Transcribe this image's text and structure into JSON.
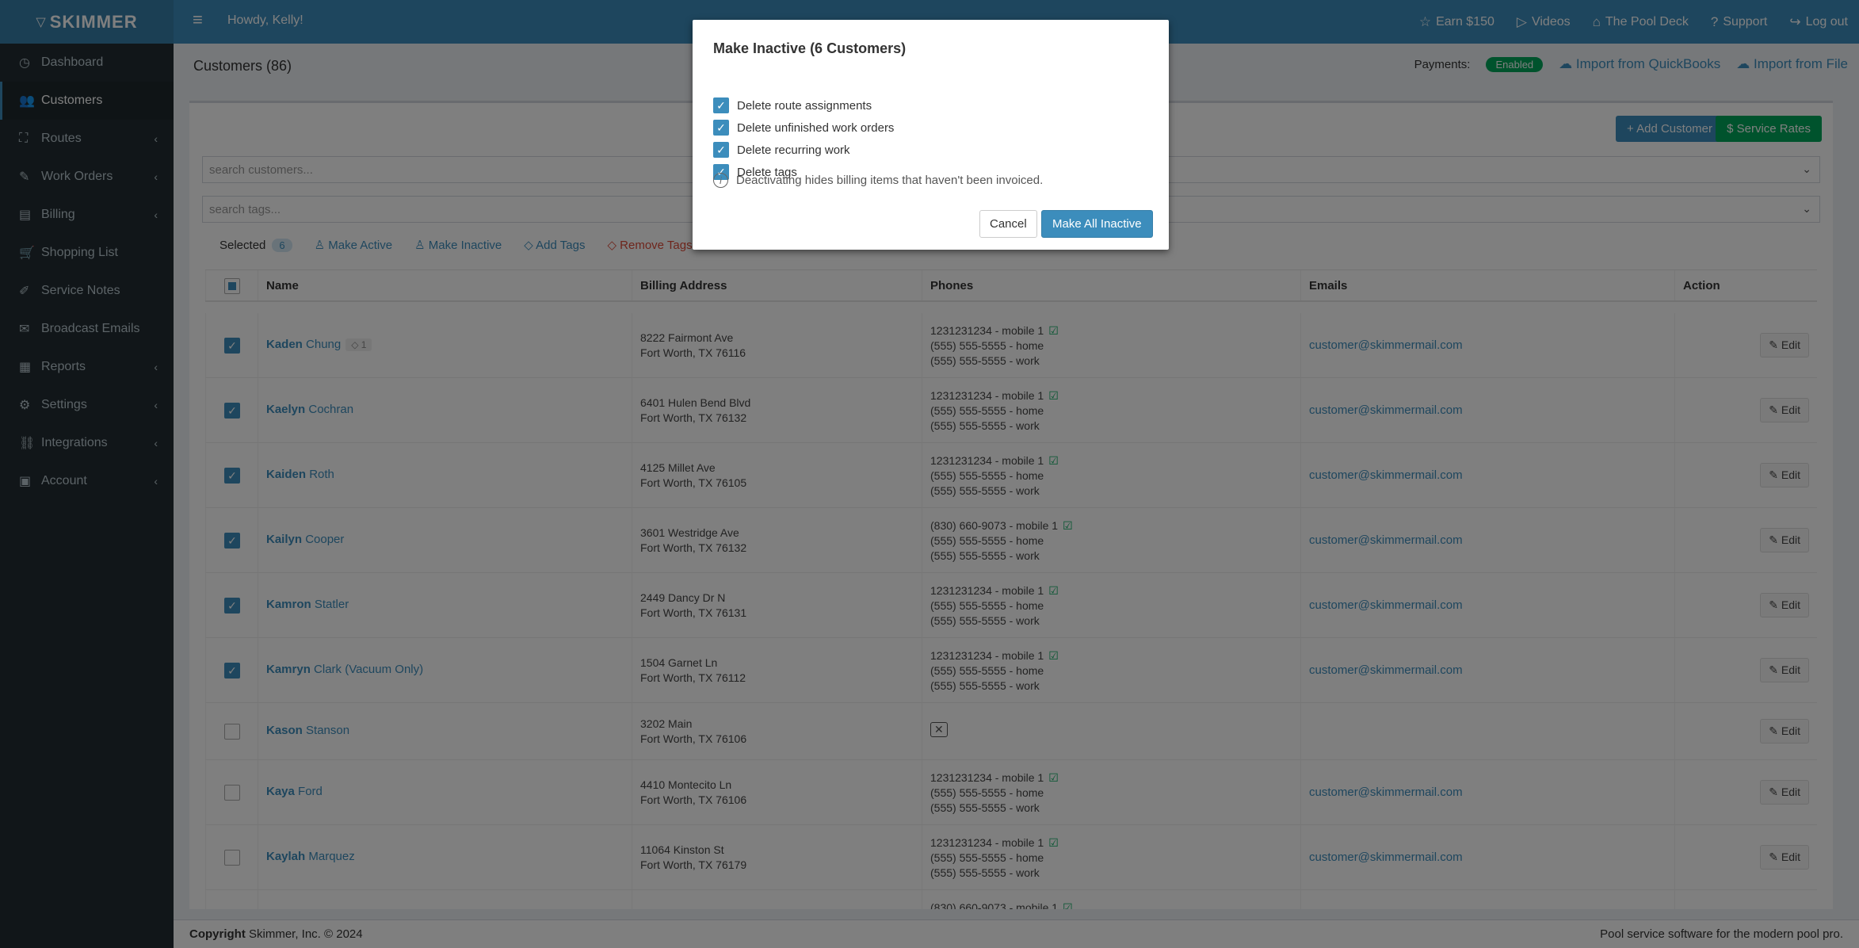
{
  "app": {
    "logo": "SKIMMER",
    "greeting": "Howdy, Kelly!"
  },
  "topnav": [
    {
      "icon": "star-icon",
      "glyph": "☆",
      "label": "Earn $150"
    },
    {
      "icon": "play-icon",
      "glyph": "▷",
      "label": "Videos"
    },
    {
      "icon": "pool-icon",
      "glyph": "⌂",
      "label": "The Pool Deck"
    },
    {
      "icon": "question-icon",
      "glyph": "?",
      "label": "Support"
    },
    {
      "icon": "logout-icon",
      "glyph": "↪",
      "label": "Log out"
    }
  ],
  "sidebar": {
    "items": [
      {
        "label": "Dashboard",
        "glyph": "◷",
        "chevron": false,
        "active": false
      },
      {
        "label": "Customers",
        "glyph": "👥",
        "chevron": false,
        "active": true
      },
      {
        "label": "Routes",
        "glyph": "⛶",
        "chevron": true,
        "active": false
      },
      {
        "label": "Work Orders",
        "glyph": "✎",
        "chevron": true,
        "active": false
      },
      {
        "label": "Billing",
        "glyph": "▤",
        "chevron": true,
        "active": false
      },
      {
        "label": "Shopping List",
        "glyph": "🛒",
        "chevron": false,
        "active": false
      },
      {
        "label": "Service Notes",
        "glyph": "✐",
        "chevron": false,
        "active": false
      },
      {
        "label": "Broadcast Emails",
        "glyph": "✉",
        "chevron": false,
        "active": false
      },
      {
        "label": "Reports",
        "glyph": "▦",
        "chevron": true,
        "active": false
      },
      {
        "label": "Settings",
        "glyph": "⚙",
        "chevron": true,
        "active": false
      },
      {
        "label": "Integrations",
        "glyph": "⛓",
        "chevron": true,
        "active": false
      },
      {
        "label": "Account",
        "glyph": "▣",
        "chevron": true,
        "active": false
      }
    ]
  },
  "header": {
    "title": "Customers (86)",
    "payments_label": "Payments:",
    "payments_status": "Enabled",
    "import_qb": "Import from QuickBooks",
    "import_file": "Import from File"
  },
  "toolbar": {
    "add_customer": "+ Add Customer",
    "service_rates": "$ Service Rates",
    "search_customers_placeholder": "search customers...",
    "search_tags_placeholder": "search tags...",
    "selected_label": "Selected",
    "selected_count": "6",
    "make_active": "Make Active",
    "make_inactive": "Make Inactive",
    "add_tags": "Add Tags",
    "remove_tags": "Remove Tags"
  },
  "table": {
    "headers": [
      "Name",
      "Billing Address",
      "Phones",
      "Emails",
      "Action"
    ],
    "edit_label": "Edit",
    "rows": [
      {
        "checked": true,
        "first": "Kaden",
        "last": "Chung",
        "tag": "1",
        "addr1": "8222 Fairmont Ave",
        "addr2": "Fort Worth, TX 76116",
        "phones": [
          "1231231234 - mobile 1",
          "(555) 555-5555 - home",
          "(555) 555-5555 - work"
        ],
        "sms": true,
        "email": "customer@skimmermail.com"
      },
      {
        "checked": true,
        "first": "Kaelyn",
        "last": "Cochran",
        "tag": "",
        "addr1": "6401 Hulen Bend Blvd",
        "addr2": "Fort Worth, TX 76132",
        "phones": [
          "1231231234 - mobile 1",
          "(555) 555-5555 - home",
          "(555) 555-5555 - work"
        ],
        "sms": true,
        "email": "customer@skimmermail.com"
      },
      {
        "checked": true,
        "first": "Kaiden",
        "last": "Roth",
        "tag": "",
        "addr1": "4125 Millet Ave",
        "addr2": "Fort Worth, TX 76105",
        "phones": [
          "1231231234 - mobile 1",
          "(555) 555-5555 - home",
          "(555) 555-5555 - work"
        ],
        "sms": true,
        "email": "customer@skimmermail.com"
      },
      {
        "checked": true,
        "first": "Kailyn",
        "last": "Cooper",
        "tag": "",
        "addr1": "3601 Westridge Ave",
        "addr2": "Fort Worth, TX 76132",
        "phones": [
          "(830) 660-9073 - mobile 1",
          "(555) 555-5555 - home",
          "(555) 555-5555 - work"
        ],
        "sms": true,
        "email": "customer@skimmermail.com"
      },
      {
        "checked": true,
        "first": "Kamron",
        "last": "Statler",
        "tag": "",
        "addr1": "2449 Dancy Dr N",
        "addr2": "Fort Worth, TX 76131",
        "phones": [
          "1231231234 - mobile 1",
          "(555) 555-5555 - home",
          "(555) 555-5555 - work"
        ],
        "sms": true,
        "email": "customer@skimmermail.com"
      },
      {
        "checked": true,
        "first": "Kamryn",
        "last": "Clark (Vacuum Only)",
        "tag": "",
        "addr1": "1504 Garnet Ln",
        "addr2": "Fort Worth, TX 76112",
        "phones": [
          "1231231234 - mobile 1",
          "(555) 555-5555 - home",
          "(555) 555-5555 - work"
        ],
        "sms": true,
        "email": "customer@skimmermail.com"
      },
      {
        "checked": false,
        "first": "Kason",
        "last": "Stanson",
        "tag": "",
        "addr1": "3202 Main",
        "addr2": "Fort Worth, TX 76106",
        "phones": [],
        "sms": false,
        "email": ""
      },
      {
        "checked": false,
        "first": "Kaya",
        "last": "Ford",
        "tag": "",
        "addr1": "4410 Montecito Ln",
        "addr2": "Fort Worth, TX 76106",
        "phones": [
          "1231231234 - mobile 1",
          "(555) 555-5555 - home",
          "(555) 555-5555 - work"
        ],
        "sms": true,
        "email": "customer@skimmermail.com"
      },
      {
        "checked": false,
        "first": "Kaylah",
        "last": "Marquez",
        "tag": "",
        "addr1": "11064 Kinston St",
        "addr2": "Fort Worth, TX 76179",
        "phones": [
          "1231231234 - mobile 1",
          "(555) 555-5555 - home",
          "(555) 555-5555 - work"
        ],
        "sms": true,
        "email": "customer@skimmermail.com"
      },
      {
        "checked": false,
        "first": "",
        "last": "",
        "tag": "",
        "addr1": "",
        "addr2": "",
        "phones": [
          "(830) 660-9073 - mobile 1"
        ],
        "sms": true,
        "email": ""
      }
    ]
  },
  "footer": {
    "copyright_bold": "Copyright",
    "copyright_rest": "Skimmer, Inc. © 2024",
    "tagline": "Pool service software for the modern pool pro."
  },
  "modal": {
    "title": "Make Inactive (6 Customers)",
    "options": [
      "Delete route assignments",
      "Delete unfinished work orders",
      "Delete recurring work",
      "Delete tags"
    ],
    "info": "Deactivating hides billing items that haven't been invoiced.",
    "cancel": "Cancel",
    "confirm": "Make All Inactive"
  }
}
